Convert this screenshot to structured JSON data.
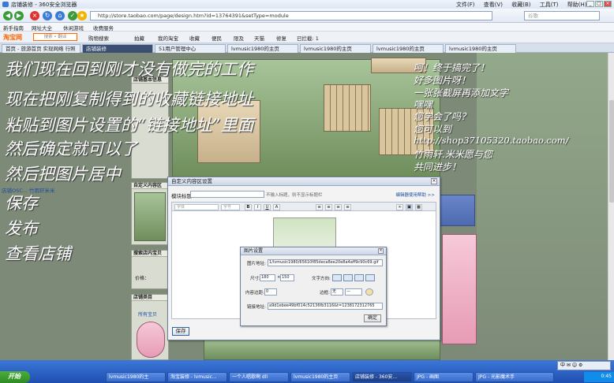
{
  "window": {
    "title": "店铺装修 - 360安全浏览器",
    "menus": [
      "文件(F)",
      "查看(V)",
      "收藏(B)",
      "工具(T)",
      "帮助(H)"
    ]
  },
  "navbar": {
    "address": "http://store.taobao.com/page/design.htm?id=13764391&setType=module",
    "search_placeholder": "谷歌"
  },
  "favorites": [
    "新手指南",
    "网址大全",
    "休闲游戏",
    "收费服务"
  ],
  "taobao_toolbar": {
    "logo": "淘宝网",
    "search_placeholder": "搜索 • 翻译",
    "items": [
      "购物搜索",
      "拍藏",
      "我的淘宝",
      "收藏",
      "便民",
      "限及",
      "天猫",
      "修复",
      "已拦截: 1"
    ]
  },
  "tabs": [
    "首页 - 旅游首页 实现网络 行照",
    "店铺装修",
    "51用户管理中心",
    "lvmusic1980的主页",
    "lvmusic1980的主页",
    "lvmusic1980的主页",
    "lvmusic1980的主页"
  ],
  "page": {
    "sidebar_headers": [
      "店铺基本信息",
      "自定义内容区",
      "搜索店内宝贝",
      "店铺类目"
    ],
    "shop_text": "店铺OSC... 竹雨轩米米",
    "price_label": "价格：",
    "category_item": "所有宝贝"
  },
  "editor_dialog": {
    "title": "自定义内容区设置",
    "module_title_label": "模块标题",
    "module_title_hint": "不输入标题，则不显示标题栏",
    "help_link": "编辑器使用帮助 >>",
    "font_select": "字体",
    "size_select": "字号",
    "toolbar_buttons": [
      "B",
      "I",
      "U",
      "A",
      "≡",
      "≡",
      "≡",
      "≡"
    ],
    "save_label": "保存"
  },
  "image_dialog": {
    "title": "图片设置",
    "image_url_label": "图片地址:",
    "image_url_value": "1/lvmusic1980/65610f85deca8ee20e8a4aff9c90c69.gif",
    "size_label": "尺寸:",
    "width_value": "180",
    "height_value": "150",
    "align_label": "文字方向:",
    "margin_label": "内容边距:",
    "margin_value": "0",
    "border_label": "边框:",
    "border_value": "无",
    "link_label": "链接地址:",
    "link_value": "a9d1ebee49bf014c52136fb3116&t=1238172312765",
    "ok_label": "确定"
  },
  "notes_left": [
    "我们现在回到刚才没有做完的工作",
    "现在把刚复制得到的收藏链接地址",
    "粘贴到图片设置的“链接地址”里面",
    "然后确定就可以了",
    "然后把图片居中",
    "保存",
    "发布",
    "查看店铺"
  ],
  "notes_right": [
    "呵！终于搞完了！",
    "好多图片呀！",
    "一张张截屏再添加文字",
    "嘿嘿",
    "您学会了吗？",
    "您可以到",
    "http://shop37105320.taobao.com/",
    "竹雨轩.米米愿与您",
    "共同进步！"
  ],
  "taskbar": {
    "start": "开始",
    "tasks": [
      "lvmusic1980的主",
      "淘宝装修 - lvmusic...",
      "一个人唱歌啊 dll",
      "lvmusic1980的主页",
      "店铺装修 - 360安...",
      "JPG - 画图",
      "JPG - 光影魔术手"
    ],
    "ime": "中 ✉ ☺ ⚙",
    "clock": "0:45"
  },
  "colors": {
    "taskbar": "#1f4fb0",
    "start": "#2e8a24",
    "link": "#1a4fa0"
  }
}
